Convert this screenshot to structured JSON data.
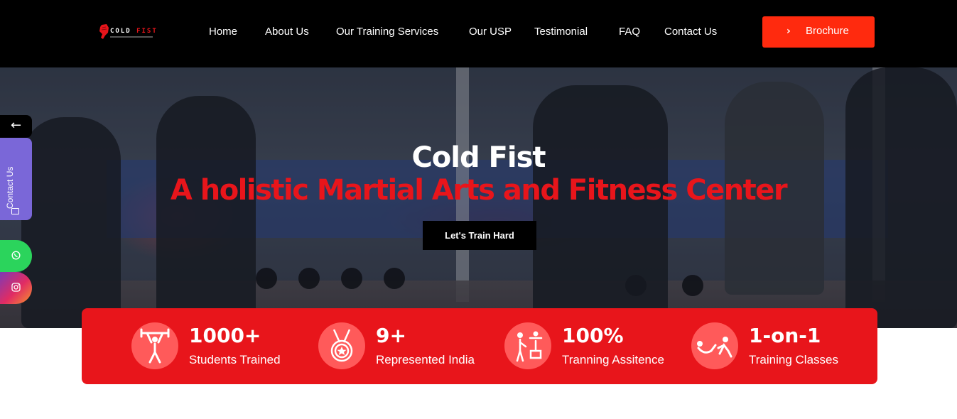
{
  "header": {
    "logo_text_white": "COLD ",
    "logo_text_red": "FIST",
    "nav": [
      "Home",
      "About Us",
      "Our Training Services",
      "Our USP",
      "Testimonial",
      "FAQ",
      "Contact Us"
    ],
    "brochure_label": "Brochure"
  },
  "hero": {
    "title": "Cold Fist",
    "subtitle": "A holistic Martial Arts and Fitness Center",
    "cta_label": "Let's Train Hard"
  },
  "side": {
    "back_arrow": "←",
    "contact_label": "Contact Us"
  },
  "stats": [
    {
      "number": "1000+",
      "caption": "Students Trained",
      "icon": "weightlifter-icon"
    },
    {
      "number": "9+",
      "caption": "Represented India",
      "icon": "medal-icon"
    },
    {
      "number": "100%",
      "caption": "Tranning Assitence",
      "icon": "trainer-icon"
    },
    {
      "number": "1-on-1",
      "caption": "Training Classes",
      "icon": "partner-exercise-icon"
    }
  ],
  "colors": {
    "accent_red": "#e8151b",
    "brochure_orange": "#ff2a0e",
    "contact_purple": "#7a67d8",
    "whatsapp_green": "#2bd45c"
  }
}
